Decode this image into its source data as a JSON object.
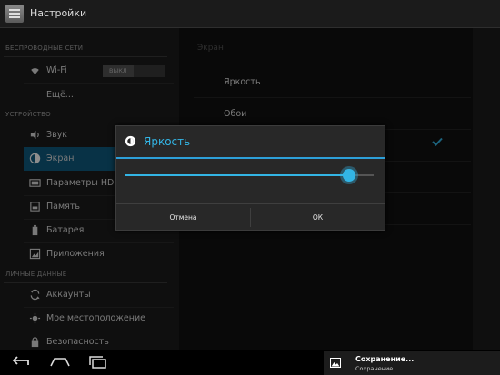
{
  "app": {
    "title": "Настройки"
  },
  "sidebar": {
    "sections": [
      {
        "label": "БЕСПРОВОДНЫЕ СЕТИ"
      },
      {
        "label": "УСТРОЙСТВО"
      },
      {
        "label": "ЛИЧНЫЕ ДАННЫЕ"
      }
    ],
    "items": [
      {
        "label": "Wi-Fi",
        "icon": "wifi-icon"
      },
      {
        "label": "Ещё...",
        "icon": ""
      },
      {
        "label": "Звук",
        "icon": "speaker-icon"
      },
      {
        "label": "Экран",
        "icon": "display-icon",
        "selected": true
      },
      {
        "label": "Параметры HDMI",
        "icon": "hdmi-icon"
      },
      {
        "label": "Память",
        "icon": "storage-icon"
      },
      {
        "label": "Батарея",
        "icon": "battery-icon"
      },
      {
        "label": "Приложения",
        "icon": "apps-icon"
      },
      {
        "label": "Аккаунты",
        "icon": "sync-icon"
      },
      {
        "label": "Мое местоположение",
        "icon": "location-icon"
      },
      {
        "label": "Безопасность",
        "icon": "lock-icon"
      }
    ],
    "wifi_toggle": {
      "label": "ВЫКЛ",
      "state": "off"
    }
  },
  "right_pane": {
    "header": "Экран",
    "items": [
      {
        "label": "Яркость"
      },
      {
        "label": "Обои"
      }
    ]
  },
  "dialog": {
    "title": "Яркость",
    "icon": "brightness-icon",
    "slider_value": 0.9,
    "cancel_label": "Отмена",
    "ok_label": "ОК"
  },
  "navbar": {
    "buttons": [
      "back-icon",
      "home-icon",
      "recent-apps-icon"
    ]
  },
  "notification": {
    "title": "Сохранение...",
    "subtitle": "Сохранение...",
    "icon": "image-icon"
  },
  "colors": {
    "accent": "#33b5e5",
    "selected": "#0f5c80"
  }
}
